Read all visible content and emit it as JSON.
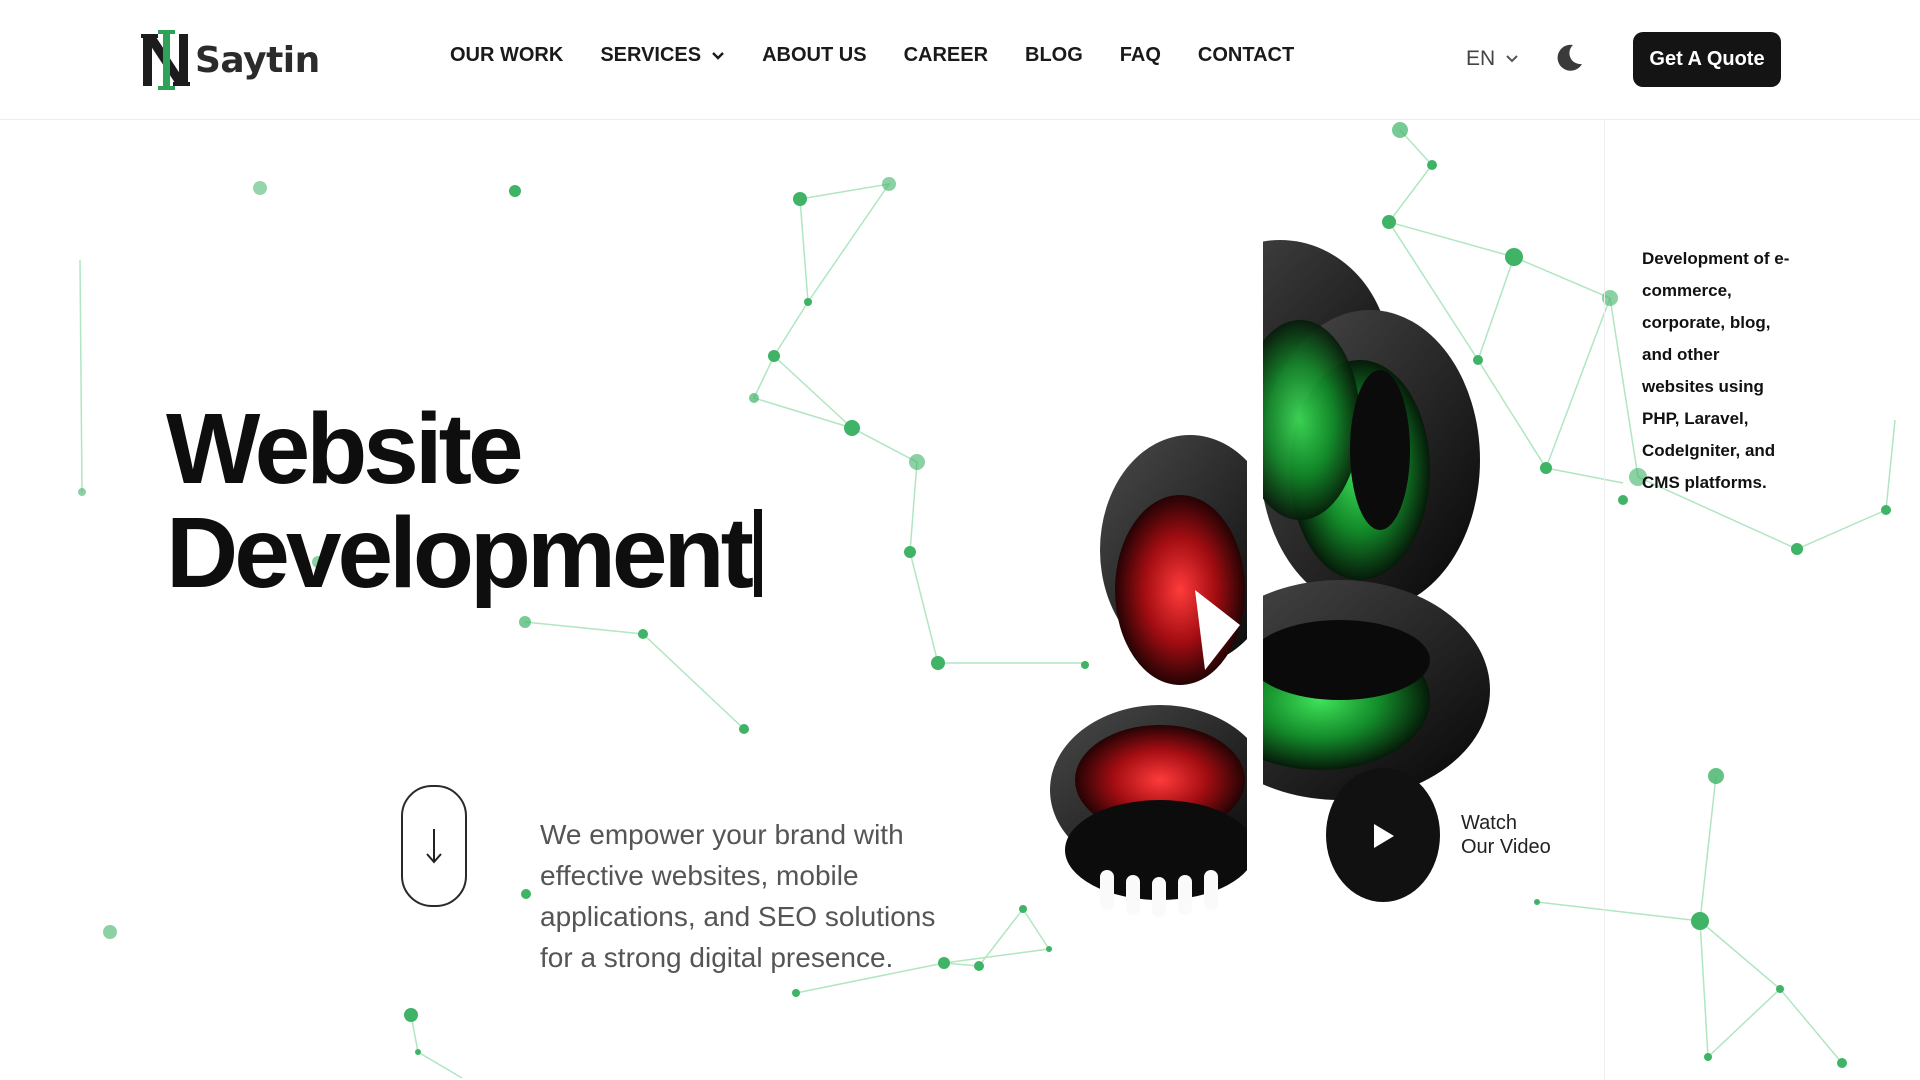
{
  "header": {
    "logo_text": "Saytin",
    "nav": [
      {
        "label": "OUR WORK"
      },
      {
        "label": "SERVICES",
        "has_dropdown": true
      },
      {
        "label": "ABOUT US"
      },
      {
        "label": "CAREER"
      },
      {
        "label": "BLOG"
      },
      {
        "label": "FAQ"
      },
      {
        "label": "CONTACT"
      }
    ],
    "language": "EN",
    "theme_icon": "moon-icon",
    "cta_label": "Get A Quote"
  },
  "hero": {
    "title_line1": "Website",
    "title_line2": "Development",
    "tagline": "We empower your brand with effective websites, mobile applications, and SEO solutions for a strong digital presence.",
    "side_description": "Development of e-commerce, corporate, blog, and other websites using PHP, Laravel, CodeIgniter, and CMS platforms.",
    "video_label_line1": "Watch",
    "video_label_line2": "Our Video"
  },
  "colors": {
    "accent_green": "#2fa25a",
    "network_green": "#5ec27f",
    "dark": "#141414"
  }
}
